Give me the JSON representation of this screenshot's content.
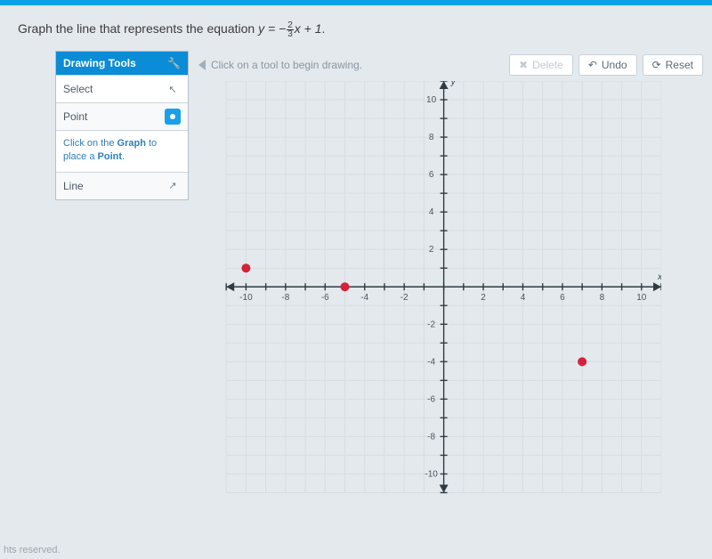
{
  "prompt": {
    "text_before": "Graph the line that represents the equation ",
    "equation_lhs": "y = −",
    "equation_frac_num": "2",
    "equation_frac_den": "3",
    "equation_rhs": "x + 1",
    "trailing": "."
  },
  "sidebar": {
    "title": "Drawing Tools",
    "select_label": "Select",
    "point_label": "Point",
    "line_label": "Line",
    "hint_before": "Click on the ",
    "hint_bold1": "Graph",
    "hint_mid": " to place a ",
    "hint_bold2": "Point",
    "hint_after": "."
  },
  "toolbar": {
    "hint": "Click on a tool to begin drawing.",
    "delete_label": "Delete",
    "undo_label": "Undo",
    "reset_label": "Reset"
  },
  "chart_data": {
    "type": "scatter",
    "title": "",
    "xlabel": "x",
    "ylabel": "y",
    "xlim": [
      -11,
      11
    ],
    "ylim": [
      -11,
      11
    ],
    "xticks": [
      -10,
      -8,
      -6,
      -4,
      -2,
      2,
      4,
      6,
      8,
      10
    ],
    "yticks": [
      -10,
      -8,
      -6,
      -4,
      -2,
      2,
      4,
      6,
      8,
      10
    ],
    "grid": true,
    "series": [
      {
        "name": "points",
        "x": [
          -10,
          -5,
          7
        ],
        "y": [
          1,
          0,
          -4
        ],
        "color": "#d6213a"
      }
    ]
  },
  "footer": {
    "text": "hts reserved."
  }
}
